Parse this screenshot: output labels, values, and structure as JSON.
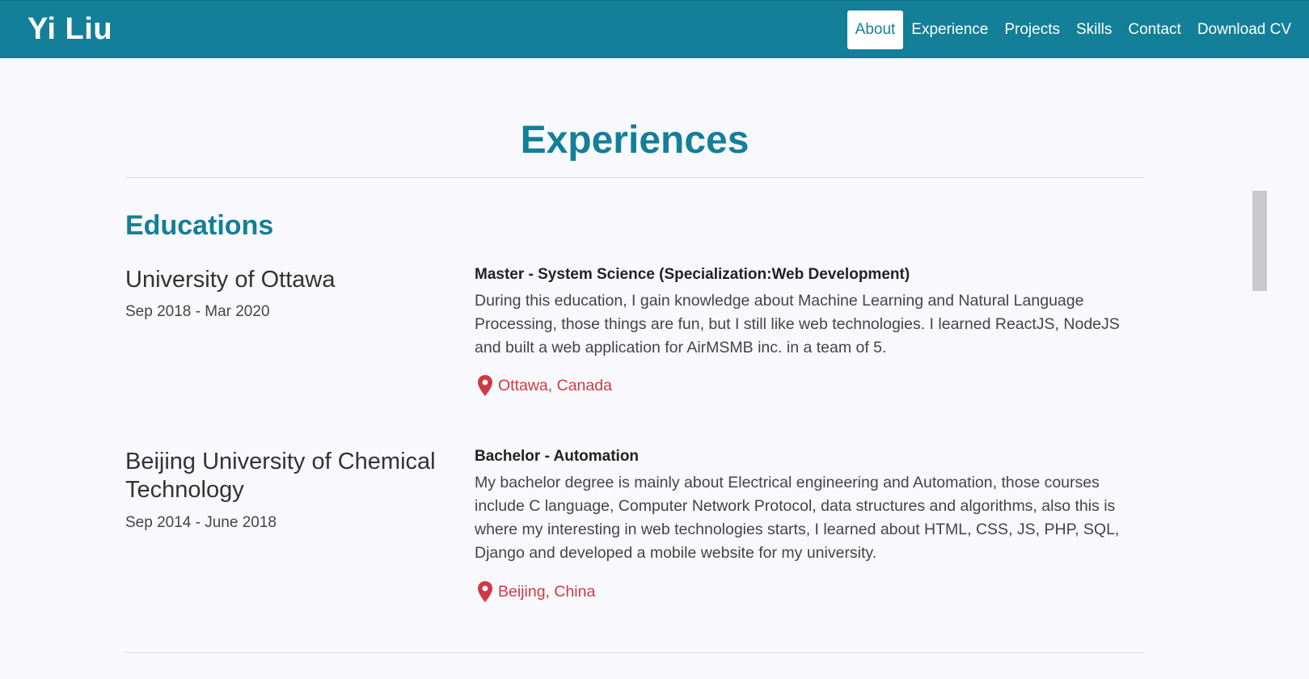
{
  "navbar": {
    "brand": "Yi Liu",
    "links": [
      "About",
      "Experience",
      "Projects",
      "Skills",
      "Contact",
      "Download CV"
    ]
  },
  "page": {
    "title": "Experiences",
    "section_title": "Educations"
  },
  "educations": [
    {
      "school": "University of Ottawa",
      "dates": "Sep 2018 - Mar 2020",
      "degree": "Master - System Science (Specialization:Web Development)",
      "description": "During this education, I gain knowledge about Machine Learning and Natural Language Processing, those things are fun, but I still like web technologies. I learned ReactJS, NodeJS and built a web application for AirMSMB inc. in a team of 5.",
      "location": "Ottawa, Canada",
      "location_icon": "map-pin-icon"
    },
    {
      "school": "Beijing University of Chemical Technology",
      "dates": "Sep 2014 - June 2018",
      "degree": "Bachelor - Automation",
      "description": "My bachelor degree is mainly about Electrical engineering and Automation, those courses include C language, Computer Network Protocol, data structures and algorithms, also this is where my interesting in web technologies starts, I learned about HTML, CSS, JS, PHP, SQL, Django and developed a mobile website for my university.",
      "location": "Beijing, China",
      "location_icon": "map-pin-icon"
    }
  ],
  "colors": {
    "primary": "#137f98",
    "location": "#d03a44",
    "background": "#f9f9fd"
  }
}
